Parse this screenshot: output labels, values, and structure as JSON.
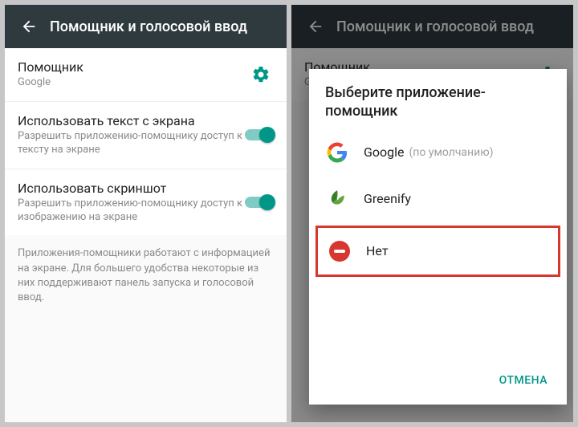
{
  "appbar": {
    "title": "Помощник и голосовой ввод"
  },
  "left": {
    "assistant": {
      "title": "Помощник",
      "subtitle": "Google"
    },
    "useText": {
      "title": "Использовать текст с экрана",
      "subtitle": "Разрешить приложению-помощнику доступ к тексту на экране",
      "enabled": true
    },
    "useScreenshot": {
      "title": "Использовать скриншот",
      "subtitle": "Разрешить приложению-помощнику доступ к изображению на экране",
      "enabled": true
    },
    "footer": "Приложения-помощники работают с информацией на экране. Для большего удобства некоторые из них поддерживают панель запуска и голосовой ввод."
  },
  "right": {
    "assistant": {
      "title": "Помощник",
      "subtitle": "G"
    }
  },
  "dialog": {
    "title": "Выберите приложение-помощник",
    "options": {
      "google": {
        "label": "Google",
        "hint": "(по умолчанию)"
      },
      "greenify": {
        "label": "Greenify"
      },
      "none": {
        "label": "Нет"
      }
    },
    "cancel": "ОТМЕНА"
  }
}
